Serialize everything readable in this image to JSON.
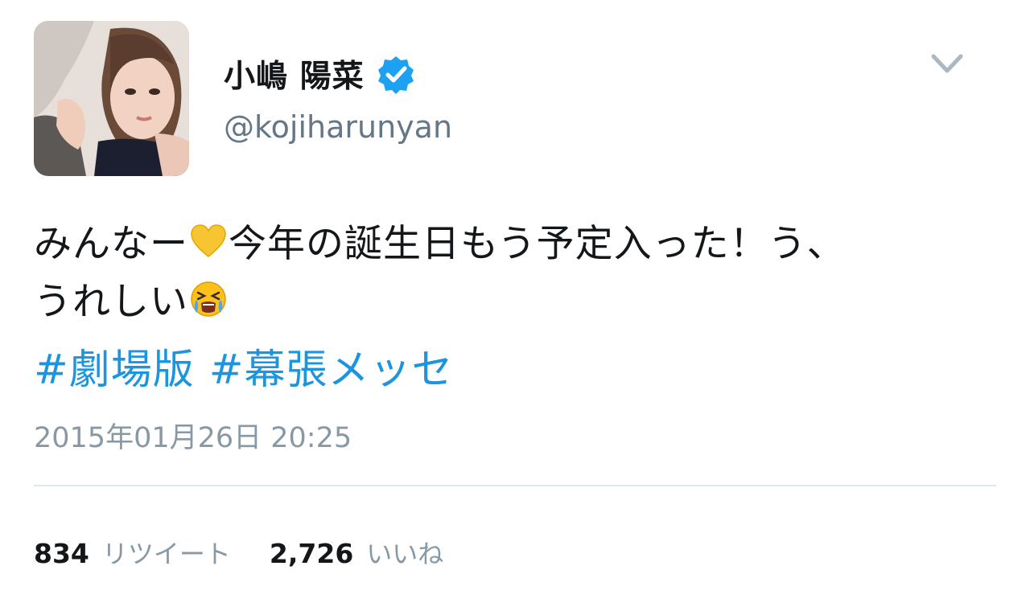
{
  "user": {
    "display_name": "小嶋 陽菜",
    "handle": "@kojiharunyan",
    "verified_icon": "verified-badge-icon",
    "avatar": "profile-photo"
  },
  "menu": {
    "icon": "chevron-down-icon"
  },
  "tweet": {
    "line1_a": "みんなー",
    "emoji1": "yellow-heart",
    "line1_b": "今年の誕生日もう予定入った！う、",
    "line2": "うれしい",
    "emoji2": "crying-face",
    "hashtags": [
      "#劇場版",
      "#幕張メッセ"
    ]
  },
  "timestamp": "2015年01月26日 20:25",
  "stats": {
    "retweets_count": "834",
    "retweets_label": "リツイート",
    "likes_count": "2,726",
    "likes_label": "いいね"
  },
  "colors": {
    "link": "#1b95e0",
    "muted": "#657786",
    "verified": "#1da1f2",
    "divider": "#e1e8ed"
  }
}
